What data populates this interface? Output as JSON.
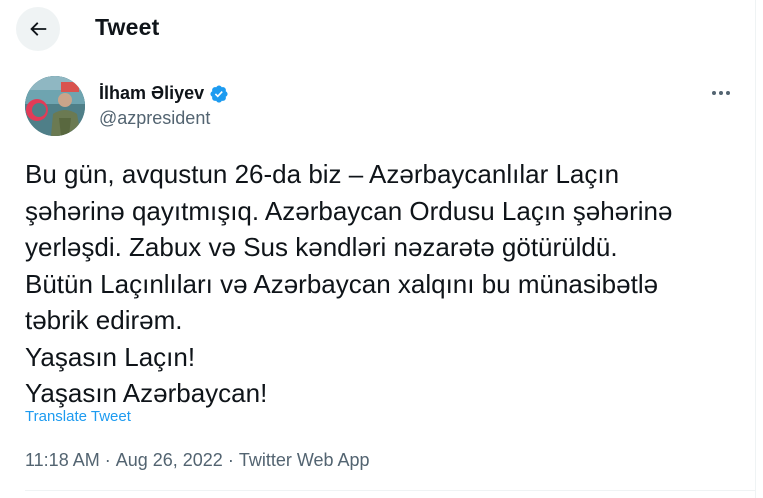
{
  "header": {
    "title": "Tweet"
  },
  "author": {
    "name": "İlham Əliyev",
    "handle": "@azpresident",
    "verified": true
  },
  "tweet": {
    "text": "Bu gün, avqustun 26-da biz – Azərbaycanlılar Laçın\nşəhərinə qayıtmışıq. Azərbaycan Ordusu Laçın şəhərinə\nyerləşdi. Zabux və Sus kəndləri nəzarətə götürüldü.\nBütün Laçınlıları və Azərbaycan xalqını bu münasibətlə\ntəbrik edirəm.\nYaşasın Laçın!\nYaşasın Azərbaycan!",
    "translate_label": "Translate Tweet"
  },
  "meta": {
    "time": "11:18 AM",
    "sep1": " · ",
    "date": "Aug 26, 2022",
    "sep2": " · ",
    "source": "Twitter Web App"
  },
  "icons": {
    "back": "arrow-left-icon",
    "verified": "verified-badge-icon",
    "more": "more-horizontal-icon"
  },
  "colors": {
    "accent": "#1d9bf0",
    "secondary_text": "#536471",
    "text": "#0f1419"
  }
}
